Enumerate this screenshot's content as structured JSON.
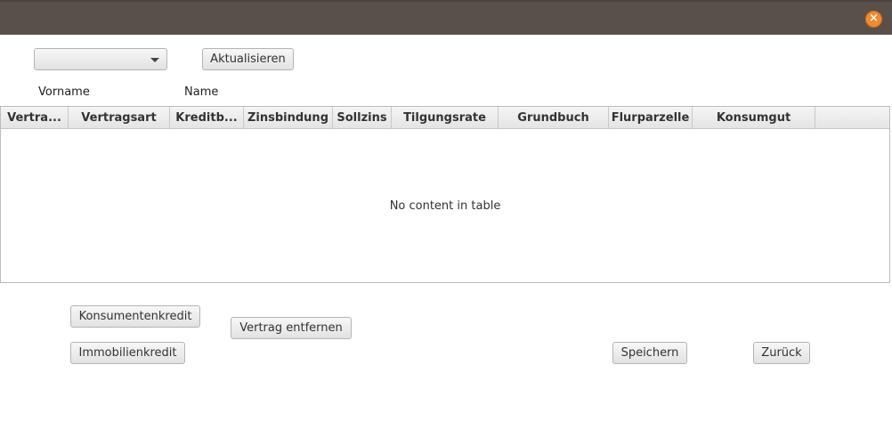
{
  "window": {
    "close_glyph": "×"
  },
  "toolbar": {
    "select_value": "",
    "refresh_label": "Aktualisieren"
  },
  "labels": {
    "firstname": "Vorname",
    "lastname": "Name"
  },
  "table": {
    "columns": [
      "Vertra...",
      "Vertragsart",
      "Kreditb...",
      "Zinsbindung",
      "Sollzins",
      "Tilgungsrate",
      "Grundbuch",
      "Flurparzelle",
      "Konsumgut"
    ],
    "placeholder": "No content in table"
  },
  "actions": {
    "consumer_credit": "Konsumentenkredit",
    "real_estate_credit": "Immobilienkredit",
    "remove_contract": "Vertrag entfernen",
    "save": "Speichern",
    "back": "Zurück"
  },
  "colors": {
    "titlebar": "#59504a",
    "close": "#f08a2d"
  }
}
